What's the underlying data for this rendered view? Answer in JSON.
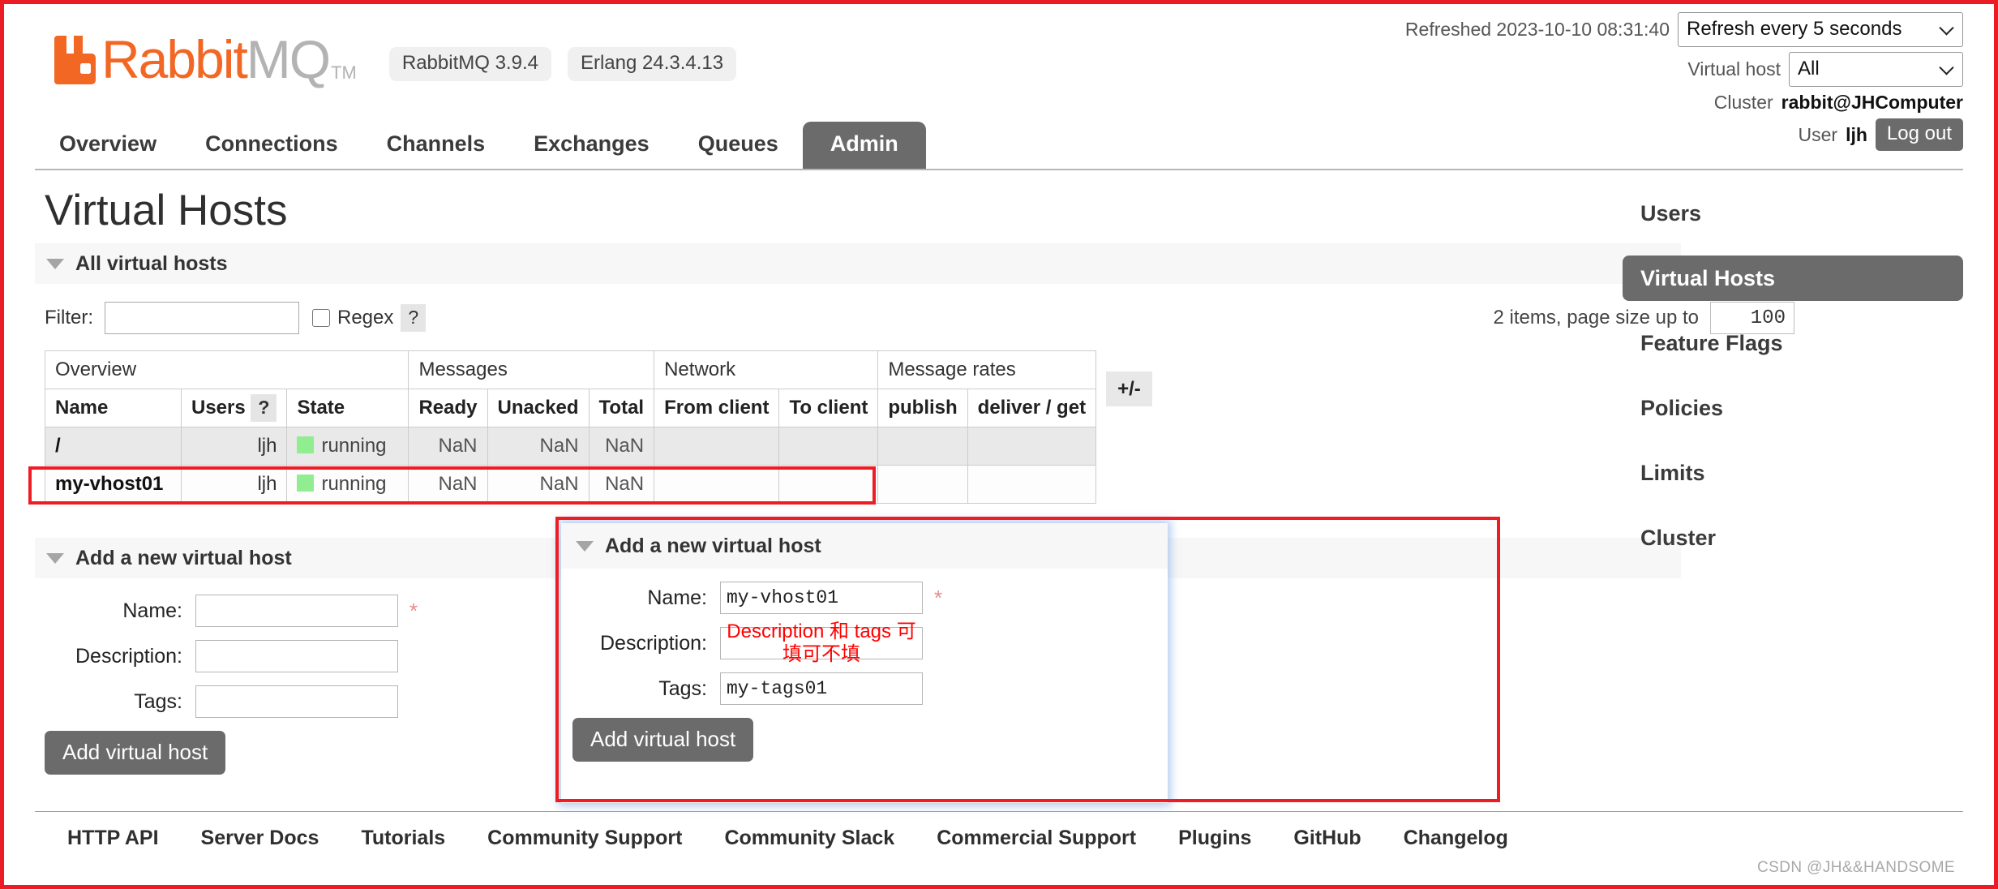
{
  "brand": {
    "name_rabbit": "Rabbit",
    "name_mq": "MQ",
    "tm": "TM",
    "version_rabbitmq": "RabbitMQ 3.9.4",
    "version_erlang": "Erlang 24.3.4.13"
  },
  "header": {
    "refreshed_label": "Refreshed 2023-10-10 08:31:40",
    "refresh_select_value": "Refresh every 5 seconds",
    "refresh_options": [
      "Refresh every 5 seconds"
    ],
    "vhost_label": "Virtual host",
    "vhost_select_value": "All",
    "vhost_options": [
      "All"
    ],
    "cluster_label": "Cluster",
    "cluster_name": "rabbit@JHComputer",
    "user_label": "User",
    "user_name": "ljh",
    "logout_label": "Log out"
  },
  "nav": {
    "tabs": [
      {
        "label": "Overview",
        "active": false
      },
      {
        "label": "Connections",
        "active": false
      },
      {
        "label": "Channels",
        "active": false
      },
      {
        "label": "Exchanges",
        "active": false
      },
      {
        "label": "Queues",
        "active": false
      },
      {
        "label": "Admin",
        "active": true
      }
    ]
  },
  "main": {
    "page_title": "Virtual Hosts",
    "all_vhosts_section_title": "All virtual hosts",
    "filter_label": "Filter:",
    "filter_value": "",
    "filter_placeholder": "",
    "regex_label": "Regex",
    "regex_help": "?",
    "regex_checked": false,
    "paging_text": "2 items, page size up to",
    "page_size_value": "100",
    "plus_minus": "+/-"
  },
  "table": {
    "group_headers": [
      {
        "label": "Overview",
        "span": 3
      },
      {
        "label": "Messages",
        "span": 3
      },
      {
        "label": "Network",
        "span": 2
      },
      {
        "label": "Message rates",
        "span": 2
      }
    ],
    "columns": [
      "Name",
      "Users",
      "State",
      "Ready",
      "Unacked",
      "Total",
      "From client",
      "To client",
      "publish",
      "deliver / get"
    ],
    "users_help": "?",
    "rows": [
      {
        "name": "/",
        "users": "ljh",
        "state": "running",
        "ready": "NaN",
        "unacked": "NaN",
        "total": "NaN",
        "from_client": "",
        "to_client": "",
        "publish": "",
        "deliver_get": ""
      },
      {
        "name": "my-vhost01",
        "users": "ljh",
        "state": "running",
        "ready": "NaN",
        "unacked": "NaN",
        "total": "NaN",
        "from_client": "",
        "to_client": "",
        "publish": "",
        "deliver_get": ""
      }
    ]
  },
  "add_form": {
    "section_title": "Add a new virtual host",
    "name_label": "Name:",
    "name_value": "",
    "description_label": "Description:",
    "description_value": "",
    "tags_label": "Tags:",
    "tags_value": "",
    "required_mark": "*",
    "submit_label": "Add virtual host"
  },
  "overlay_form": {
    "section_title": "Add a new virtual host",
    "name_label": "Name:",
    "name_value": "my-vhost01",
    "description_label": "Description:",
    "description_note": "Description 和 tags 可填可不填",
    "tags_label": "Tags:",
    "tags_value": "my-tags01",
    "required_mark": "*",
    "submit_label": "Add virtual host"
  },
  "sidebar": {
    "items": [
      {
        "label": "Users",
        "active": false
      },
      {
        "label": "Virtual Hosts",
        "active": true
      },
      {
        "label": "Feature Flags",
        "active": false
      },
      {
        "label": "Policies",
        "active": false
      },
      {
        "label": "Limits",
        "active": false
      },
      {
        "label": "Cluster",
        "active": false
      }
    ]
  },
  "footer": {
    "links": [
      "HTTP API",
      "Server Docs",
      "Tutorials",
      "Community Support",
      "Community Slack",
      "Commercial Support",
      "Plugins",
      "GitHub",
      "Changelog"
    ]
  },
  "watermark": "CSDN @JH&&HANDSOME",
  "colors": {
    "brand_orange": "#f26724",
    "accent_gray": "#6b6b6b",
    "state_green": "#90ee90",
    "annotation_red": "#ee1c25",
    "note_red": "#ff0000"
  }
}
